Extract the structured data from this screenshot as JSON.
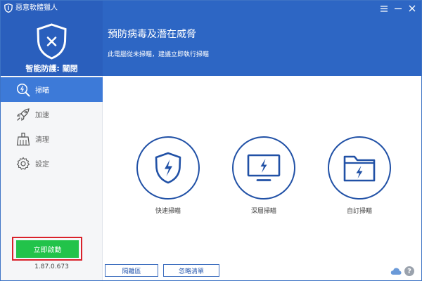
{
  "app": {
    "title": "惡意軟體獵人",
    "protection_status": "智能防護: 關閉",
    "headline": "預防病毒及潛在威脅",
    "subline": "此電腦從未掃瞄，建議立即執行掃瞄",
    "version": "1.87.0.673"
  },
  "colors": {
    "header_blue": "#2d66c4",
    "active_nav": "#3d7ad8",
    "start_green": "#22c34a",
    "highlight_red": "#d9212a",
    "scan_icon_blue": "#2151a6"
  },
  "sidebar": {
    "items": [
      {
        "label": "掃瞄",
        "icon": "scan-magnifier-icon",
        "active": true
      },
      {
        "label": "加速",
        "icon": "rocket-icon",
        "active": false
      },
      {
        "label": "清理",
        "icon": "broom-icon",
        "active": false
      },
      {
        "label": "設定",
        "icon": "gear-icon",
        "active": false
      }
    ],
    "start_button": "立即啟動"
  },
  "scans": [
    {
      "label": "快速掃瞄",
      "icon": "shield-lightning-icon"
    },
    {
      "label": "深層掃瞄",
      "icon": "monitor-lightning-icon"
    },
    {
      "label": "自訂掃瞄",
      "icon": "folder-lightning-icon"
    }
  ],
  "bottom": {
    "quarantine": "隔離區",
    "ignore_list": "忽略清單",
    "help_glyph": "?"
  }
}
